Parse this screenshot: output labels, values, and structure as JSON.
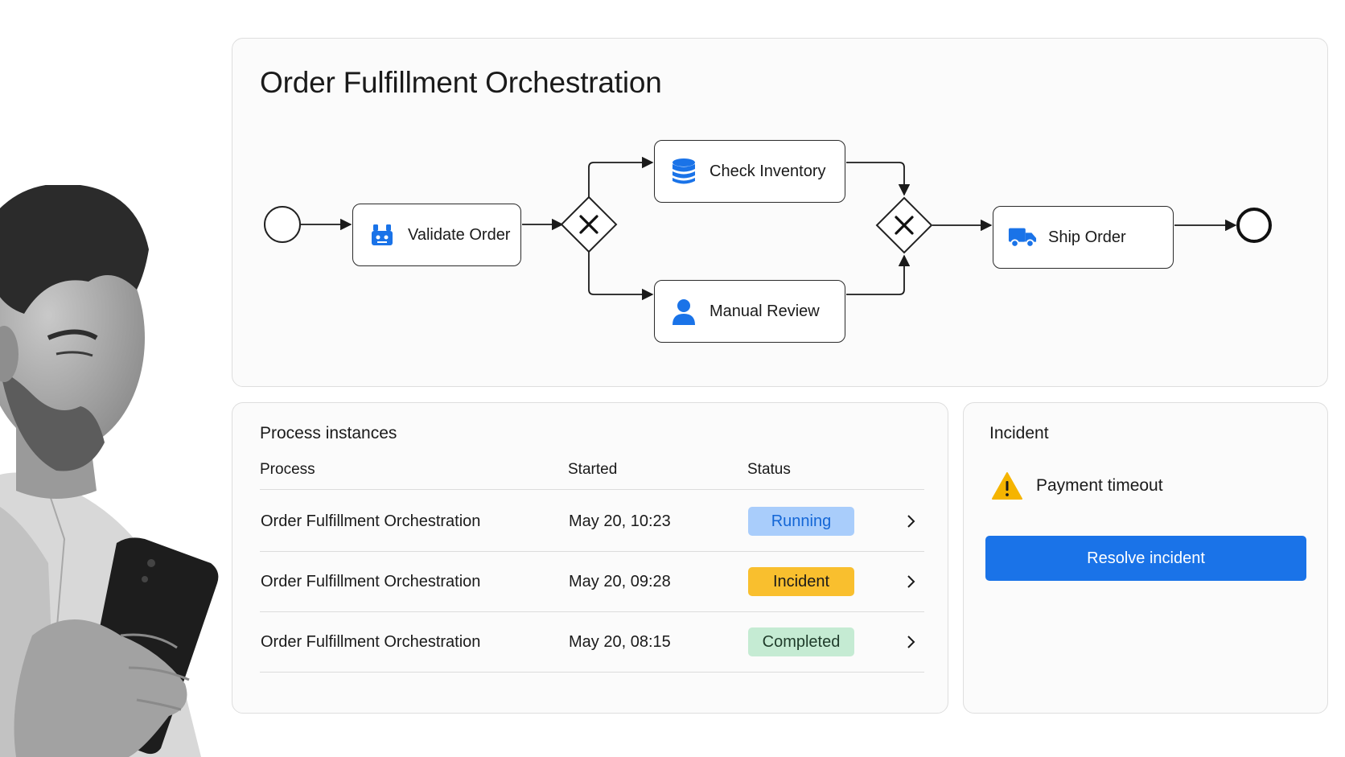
{
  "diagram": {
    "title": "Order Fulfillment Orchestration",
    "tasks": {
      "validate": {
        "label": "Validate Order",
        "icon": "robot-service-task-icon"
      },
      "inventory": {
        "label": "Check Inventory",
        "icon": "database-icon"
      },
      "review": {
        "label": "Manual Review",
        "icon": "user-icon"
      },
      "ship": {
        "label": "Ship Order",
        "icon": "truck-icon"
      }
    },
    "gateways": [
      {
        "type": "exclusive",
        "icon": "x-icon"
      },
      {
        "type": "exclusive",
        "icon": "x-icon"
      }
    ],
    "events": [
      "start-event",
      "end-event"
    ]
  },
  "instances": {
    "title": "Process instances",
    "columns": {
      "process": "Process",
      "started": "Started",
      "status": "Status"
    },
    "rows": [
      {
        "process": "Order Fulfillment Orchestration",
        "started": "May 20, 10:23",
        "status": "Running"
      },
      {
        "process": "Order Fulfillment Orchestration",
        "started": "May 20, 09:28",
        "status": "Incident"
      },
      {
        "process": "Order Fulfillment Orchestration",
        "started": "May 20, 08:15",
        "status": "Completed"
      }
    ]
  },
  "incident": {
    "title": "Incident",
    "message": "Payment timeout",
    "icon": "warning-icon",
    "resolve_label": "Resolve incident"
  },
  "colors": {
    "accent": "#1a73e8",
    "running_bg": "#a9cdfb",
    "incident_bg": "#f9bf2e",
    "completed_bg": "#c5ebd3",
    "warning": "#f5b400"
  }
}
